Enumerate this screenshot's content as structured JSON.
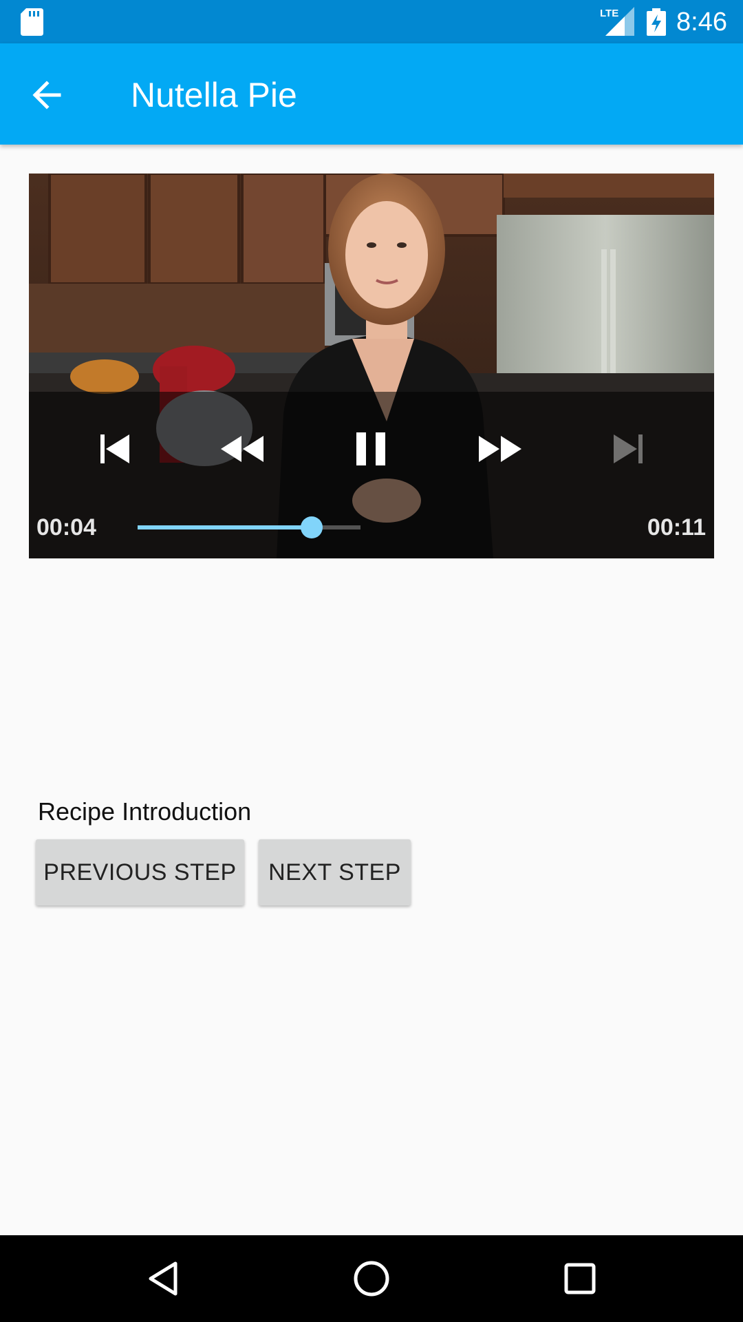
{
  "status_bar": {
    "time": "8:46",
    "network_label": "LTE",
    "icons": [
      "sd-card-icon",
      "lte-signal-icon",
      "battery-charging-icon"
    ]
  },
  "app_bar": {
    "title": "Nutella Pie",
    "back_icon": "arrow-back-icon"
  },
  "player": {
    "elapsed": "00:04",
    "duration": "00:11",
    "progress_fraction": 0.78,
    "controls": [
      "skip-previous-icon",
      "rewind-icon",
      "pause-icon",
      "fast-forward-icon",
      "skip-next-icon"
    ],
    "accent_color": "#81d4fa"
  },
  "step": {
    "title": "Recipe Introduction",
    "previous_label": "PREVIOUS STEP",
    "next_label": "NEXT STEP"
  },
  "nav_bar": {
    "icons": [
      "nav-back-icon",
      "nav-home-icon",
      "nav-recents-icon"
    ]
  },
  "colors": {
    "status_bar": "#0288d1",
    "app_bar": "#03a9f4",
    "background": "#fafafa",
    "button": "#d6d7d7"
  }
}
